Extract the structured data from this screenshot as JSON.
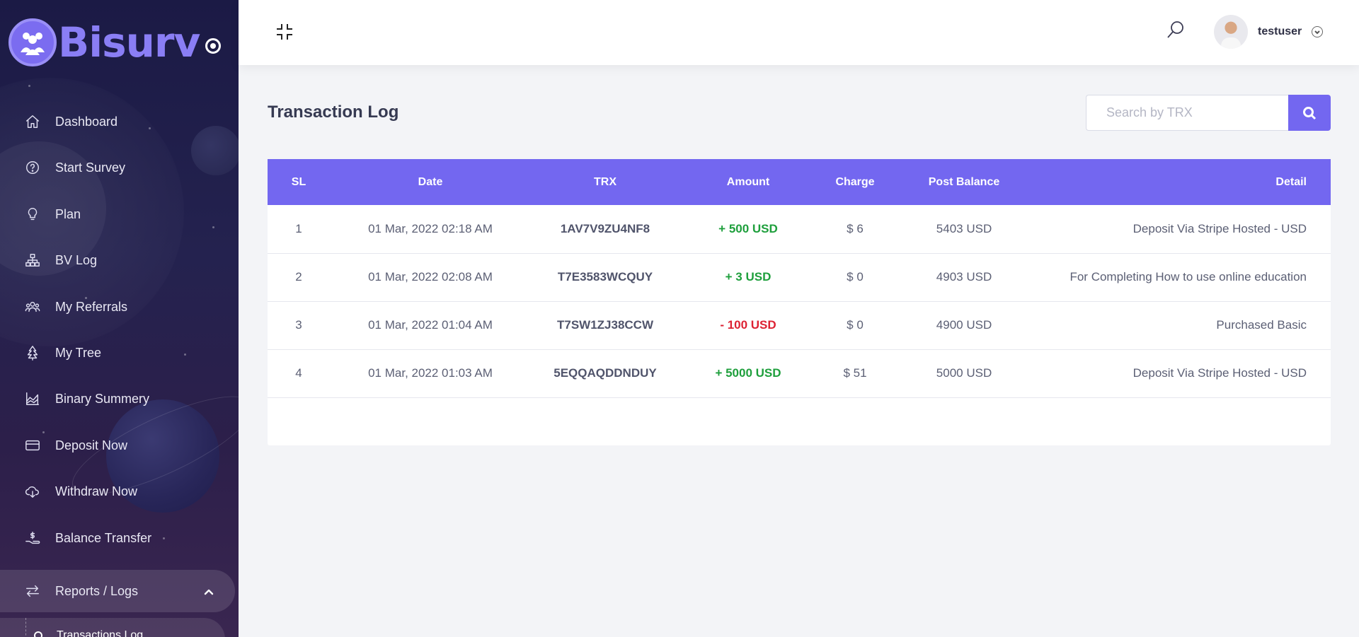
{
  "brand": {
    "name": "Bisurv"
  },
  "sidebar": {
    "items": [
      {
        "label": "Dashboard",
        "icon": "home-icon"
      },
      {
        "label": "Start Survey",
        "icon": "question-circle-icon"
      },
      {
        "label": "Plan",
        "icon": "lightbulb-icon"
      },
      {
        "label": "BV Log",
        "icon": "sitemap-icon"
      },
      {
        "label": "My Referrals",
        "icon": "users-icon"
      },
      {
        "label": "My Tree",
        "icon": "tree-icon"
      },
      {
        "label": "Binary Summery",
        "icon": "area-chart-icon"
      },
      {
        "label": "Deposit Now",
        "icon": "credit-card-icon"
      },
      {
        "label": "Withdraw Now",
        "icon": "cloud-download-icon"
      },
      {
        "label": "Balance Transfer",
        "icon": "hand-dollar-icon"
      },
      {
        "label": "Reports / Logs",
        "icon": "exchange-icon"
      }
    ],
    "sub_item": "Transactions Log"
  },
  "header": {
    "username": "testuser"
  },
  "main": {
    "title": "Transaction Log",
    "search": {
      "placeholder": "Search by TRX"
    },
    "table": {
      "headers": [
        "SL",
        "Date",
        "TRX",
        "Amount",
        "Charge",
        "Post Balance",
        "Detail"
      ],
      "rows": [
        {
          "sl": "1",
          "date": "01 Mar, 2022 02:18 AM",
          "trx": "1AV7V9ZU4NF8",
          "amount": "+ 500 USD",
          "type": "positive",
          "charge": "$ 6",
          "post_balance": "5403 USD",
          "detail": "Deposit Via Stripe Hosted - USD"
        },
        {
          "sl": "2",
          "date": "01 Mar, 2022 02:08 AM",
          "trx": "T7E3583WCQUY",
          "amount": "+ 3 USD",
          "type": "positive",
          "charge": "$ 0",
          "post_balance": "4903 USD",
          "detail": "For Completing How to use online education"
        },
        {
          "sl": "3",
          "date": "01 Mar, 2022 01:04 AM",
          "trx": "T7SW1ZJ38CCW",
          "amount": "- 100 USD",
          "type": "negative",
          "charge": "$ 0",
          "post_balance": "4900 USD",
          "detail": "Purchased Basic"
        },
        {
          "sl": "4",
          "date": "01 Mar, 2022 01:03 AM",
          "trx": "5EQQAQDDNDUY",
          "amount": "+ 5000 USD",
          "type": "positive",
          "charge": "$ 51",
          "post_balance": "5000 USD",
          "detail": "Deposit Via Stripe Hosted - USD"
        }
      ]
    }
  },
  "colors": {
    "accent": "#7367f0",
    "positive": "#1e9f3c",
    "negative": "#dd2233",
    "sidebar": "#1b1a45"
  }
}
